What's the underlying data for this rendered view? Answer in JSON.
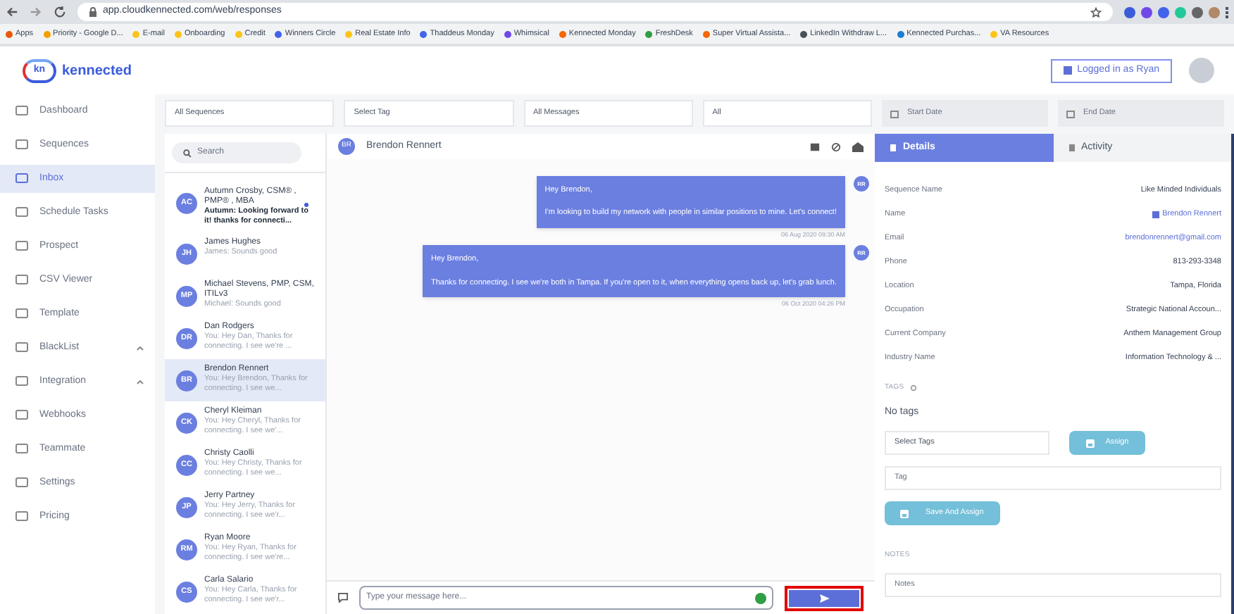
{
  "browser": {
    "url": "app.cloudkennected.com/web/responses",
    "bookmarks": [
      "Apps",
      "Priority - Google D...",
      "E-mail",
      "Onboarding",
      "Credit",
      "Winners Circle",
      "Real Estate Info",
      "Thaddeus Monday",
      "Whimsical",
      "Kennected Monday",
      "FreshDesk",
      "Super Virtual Assista...",
      "LinkedIn Withdraw L...",
      "Kennected Purchas...",
      "VA Resources"
    ]
  },
  "logo": {
    "mark": "kn",
    "text": "kennected"
  },
  "sidebar": {
    "items": [
      {
        "label": "Dashboard",
        "selected": false,
        "expandable": false
      },
      {
        "label": "Sequences",
        "selected": false,
        "expandable": false
      },
      {
        "label": "Inbox",
        "selected": true,
        "expandable": false
      },
      {
        "label": "Schedule Tasks",
        "selected": false,
        "expandable": false
      },
      {
        "label": "Prospect",
        "selected": false,
        "expandable": false
      },
      {
        "label": "CSV Viewer",
        "selected": false,
        "expandable": false
      },
      {
        "label": "Template",
        "selected": false,
        "expandable": false
      },
      {
        "label": "BlackList",
        "selected": false,
        "expandable": true
      },
      {
        "label": "Integration",
        "selected": false,
        "expandable": true
      },
      {
        "label": "Webhooks",
        "selected": false,
        "expandable": false
      },
      {
        "label": "Teammate",
        "selected": false,
        "expandable": false
      },
      {
        "label": "Settings",
        "selected": false,
        "expandable": false
      },
      {
        "label": "Pricing",
        "selected": false,
        "expandable": false
      }
    ]
  },
  "header": {
    "login_button": "Logged in as Ryan"
  },
  "filters": [
    "All Sequences",
    "Select Tag",
    "All Messages",
    "All"
  ],
  "date_fields": [
    {
      "placeholder": "Start Date"
    },
    {
      "placeholder": "End Date"
    }
  ],
  "conversations": {
    "search": {
      "placeholder": "Search"
    },
    "items": [
      {
        "initials": "AC",
        "name": "Autumn Crosby, CSM® , PMP® , MBA",
        "preview": "Autumn: Looking forward to it! thanks for connecti...",
        "selected": false,
        "unread": true
      },
      {
        "initials": "JH",
        "name": "James Hughes",
        "preview": "James: Sounds good",
        "selected": false,
        "unread": false
      },
      {
        "initials": "MP",
        "name": "Michael Stevens, PMP, CSM, ITILv3",
        "preview": "Michael: Sounds good",
        "selected": false,
        "unread": false
      },
      {
        "initials": "DR",
        "name": "Dan Rodgers",
        "preview": "You: Hey Dan, Thanks for connecting. I see we're ...",
        "selected": false,
        "unread": false
      },
      {
        "initials": "BR",
        "name": "Brendon Rennert",
        "preview": "You: Hey Brendon, Thanks for connecting. I see we...",
        "selected": true,
        "unread": false
      },
      {
        "initials": "CK",
        "name": "Cheryl Kleiman",
        "preview": "You: Hey Cheryl, Thanks for connecting. I see we'...",
        "selected": false,
        "unread": false
      },
      {
        "initials": "CC",
        "name": "Christy Caolli",
        "preview": "You: Hey Christy, Thanks for connecting. I see we...",
        "selected": false,
        "unread": false
      },
      {
        "initials": "JP",
        "name": "Jerry Partney",
        "preview": "You: Hey Jerry, Thanks for connecting. I see we'r...",
        "selected": false,
        "unread": false
      },
      {
        "initials": "RM",
        "name": "Ryan Moore",
        "preview": "You: Hey Ryan, Thanks for connecting. I see we're...",
        "selected": false,
        "unread": false
      },
      {
        "initials": "CS",
        "name": "Carla Salario",
        "preview": "You: Hey Carla, Thanks for connecting. I see we'r...",
        "selected": false,
        "unread": false
      }
    ]
  },
  "chat": {
    "contact_initials": "BR",
    "contact_name": "Brendon Rennert",
    "messages": [
      {
        "greeting": "Hey Brendon,",
        "body": "I'm looking to build my network with people in similar positions to mine. Let's connect!",
        "time": "06 Aug 2020 09:30 AM",
        "avatar": "RR"
      },
      {
        "greeting": "Hey Brendon,",
        "body": "Thanks for connecting. I see we're both in Tampa. If you're open to it, when everything opens back up, let's grab lunch.",
        "time": "06 Oct 2020 04:26 PM",
        "avatar": "RR"
      }
    ],
    "composer": {
      "placeholder": "Type your message here..."
    }
  },
  "details": {
    "tabs": [
      {
        "label": "Details",
        "selected": true
      },
      {
        "label": "Activity",
        "selected": false
      }
    ],
    "rows": [
      {
        "label": "Sequence Name",
        "value": "Like Minded Individuals",
        "kind": "plain"
      },
      {
        "label": "Name",
        "value": "Brendon Rennert",
        "kind": "contact"
      },
      {
        "label": "Email",
        "value": "brendonrennert@gmail.com",
        "kind": "link"
      },
      {
        "label": "Phone",
        "value": "813-293-3348",
        "kind": "plain"
      },
      {
        "label": "Location",
        "value": "Tampa, Florida",
        "kind": "plain"
      },
      {
        "label": "Occupation",
        "value": "Strategic National Accoun...",
        "kind": "plain"
      },
      {
        "label": "Current Company",
        "value": "Anthem Management Group",
        "kind": "plain"
      },
      {
        "label": "Industry Name",
        "value": "Information Technology & ...",
        "kind": "plain"
      }
    ],
    "tags_heading": "TAGS",
    "tags_empty": "No tags",
    "select_tags": {
      "placeholder": "Select Tags"
    },
    "assign_button": "Assign",
    "tag_field": {
      "placeholder": "Tag"
    },
    "save_button": "Save And Assign",
    "notes_heading": "NOTES",
    "notes_field": {
      "placeholder": "Notes"
    }
  }
}
